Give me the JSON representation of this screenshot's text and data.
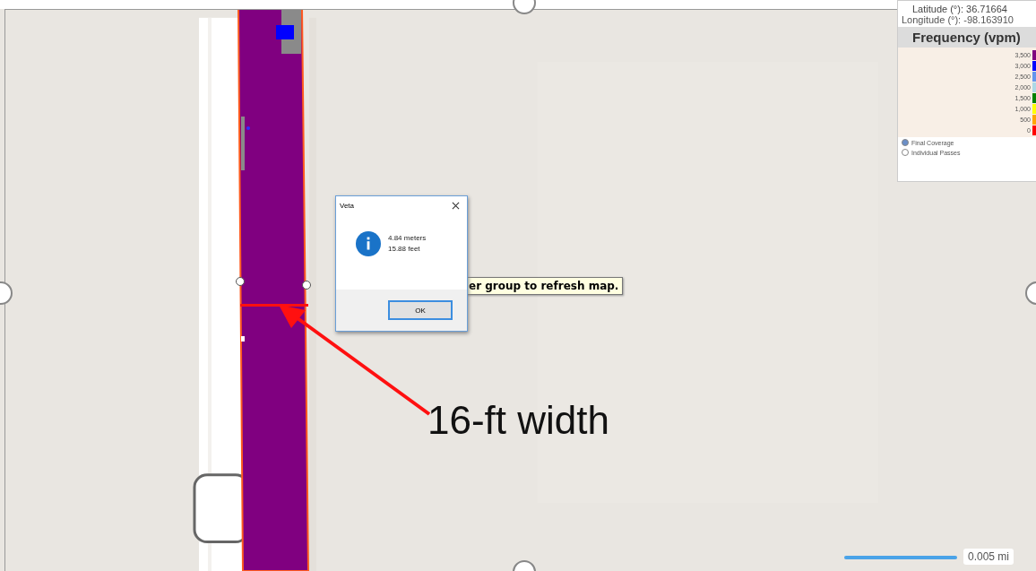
{
  "coordinates": {
    "latitude": "Latitude (°): 36.71664",
    "longitude": "Longitude (°): -98.163910"
  },
  "legend": {
    "title": "Frequency (vpm)",
    "items": [
      {
        "label": "3,500",
        "color": "#800080"
      },
      {
        "label": "3,000",
        "color": "#0000ff"
      },
      {
        "label": "2,500",
        "color": "#6495ed"
      },
      {
        "label": "2,000",
        "color": "#add8e6"
      },
      {
        "label": "1,500",
        "color": "#008000"
      },
      {
        "label": "1,000",
        "color": "#ffff00"
      },
      {
        "label": "500",
        "color": "#ffa500"
      },
      {
        "label": "0",
        "color": "#ff0000"
      }
    ]
  },
  "view_options": [
    {
      "label": "Final Coverage",
      "selected": true
    },
    {
      "label": "Individual Passes",
      "selected": false
    }
  ],
  "tooltip": "er group to refresh map.",
  "dialog": {
    "title": "Veta",
    "lines": [
      "4.84 meters",
      "15.88 feet"
    ],
    "button": "OK"
  },
  "annotation": "16-ft width",
  "scale": {
    "label": "0.005 mi"
  }
}
